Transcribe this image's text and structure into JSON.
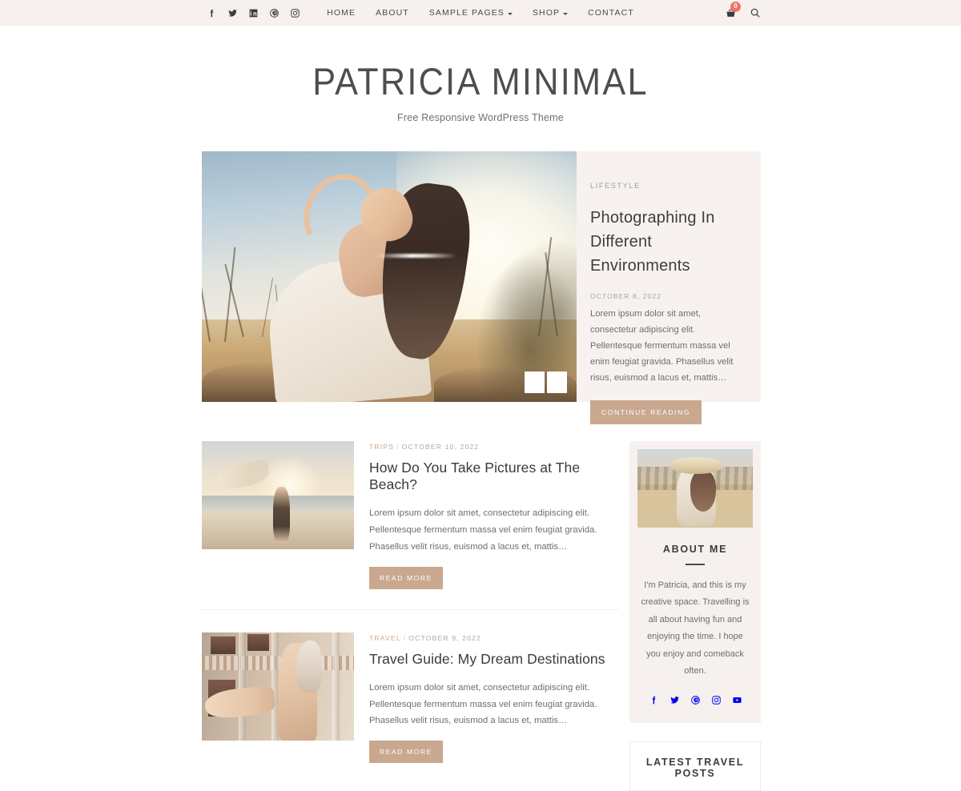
{
  "topbar": {
    "social": [
      {
        "name": "facebook-icon",
        "label": "Facebook"
      },
      {
        "name": "twitter-icon",
        "label": "Twitter"
      },
      {
        "name": "linkedin-icon",
        "label": "LinkedIn"
      },
      {
        "name": "pinterest-icon",
        "label": "Pinterest"
      },
      {
        "name": "instagram-icon",
        "label": "Instagram"
      }
    ],
    "nav": [
      {
        "label": "HOME",
        "has_caret": false
      },
      {
        "label": "ABOUT",
        "has_caret": false
      },
      {
        "label": "SAMPLE PAGES",
        "has_caret": true
      },
      {
        "label": "SHOP",
        "has_caret": true
      },
      {
        "label": "CONTACT",
        "has_caret": false
      }
    ],
    "cart_count": "0",
    "cart_icon": "shopping-basket-icon",
    "search_icon": "search-icon",
    "background": "#f6f1ee",
    "badge_color": "#f0736b"
  },
  "header": {
    "title": "PATRICIA MINIMAL",
    "tagline": "Free Responsive WordPress Theme"
  },
  "hero": {
    "category": "LIFESTYLE",
    "title": "Photographing In Different Environments",
    "date": "OCTOBER 8, 2022",
    "excerpt": "Lorem ipsum dolor sit amet, consectetur adipiscing elit. Pellentesque fermentum massa vel enim feugiat gravida. Phasellus velit risus, euismod a lacus et, mattis…",
    "cta_label": "CONTINUE READING",
    "panel_background": "#f7f2ef",
    "accent": "#c9a88f",
    "prev_icon": "chevron-left-icon",
    "next_icon": "chevron-right-icon",
    "image_alt": "Woman in white dress in golden field at sunset"
  },
  "posts": [
    {
      "category": "TRIPS",
      "separator": "/",
      "date": "OCTOBER 10, 2022",
      "title": "How Do You Take Pictures at The Beach?",
      "excerpt": "Lorem ipsum dolor sit amet, consectetur adipiscing elit. Pellentesque fermentum massa vel enim feugiat gravida. Phasellus velit risus, euismod a lacus et, mattis…",
      "cta_label": "READ MORE",
      "image_alt": "Woman holding scarf on beach at sunset"
    },
    {
      "category": "TRAVEL",
      "separator": "/",
      "date": "OCTOBER 9, 2022",
      "title": "Travel Guide: My Dream Destinations",
      "excerpt": "Lorem ipsum dolor sit amet, consectetur adipiscing elit. Pellentesque fermentum massa vel enim feugiat gravida. Phasellus velit risus, euismod a lacus et, mattis…",
      "cta_label": "READ MORE",
      "image_alt": "Blonde woman in front of colonial building"
    }
  ],
  "sidebar": {
    "about": {
      "title": "ABOUT ME",
      "text": "I'm Patricia, and this is my creative space. Travelling is all about having fun and enjoying the time. I hope you enjoy and comeback often.",
      "image_alt": "Woman in a hat standing in a golden field",
      "social": [
        {
          "name": "facebook-icon",
          "label": "Facebook"
        },
        {
          "name": "twitter-icon",
          "label": "Twitter"
        },
        {
          "name": "pinterest-icon",
          "label": "Pinterest"
        },
        {
          "name": "instagram-icon",
          "label": "Instagram"
        },
        {
          "name": "youtube-icon",
          "label": "YouTube"
        }
      ],
      "background": "#f6f1ee"
    },
    "latest": {
      "title": "LATEST TRAVEL POSTS"
    }
  }
}
